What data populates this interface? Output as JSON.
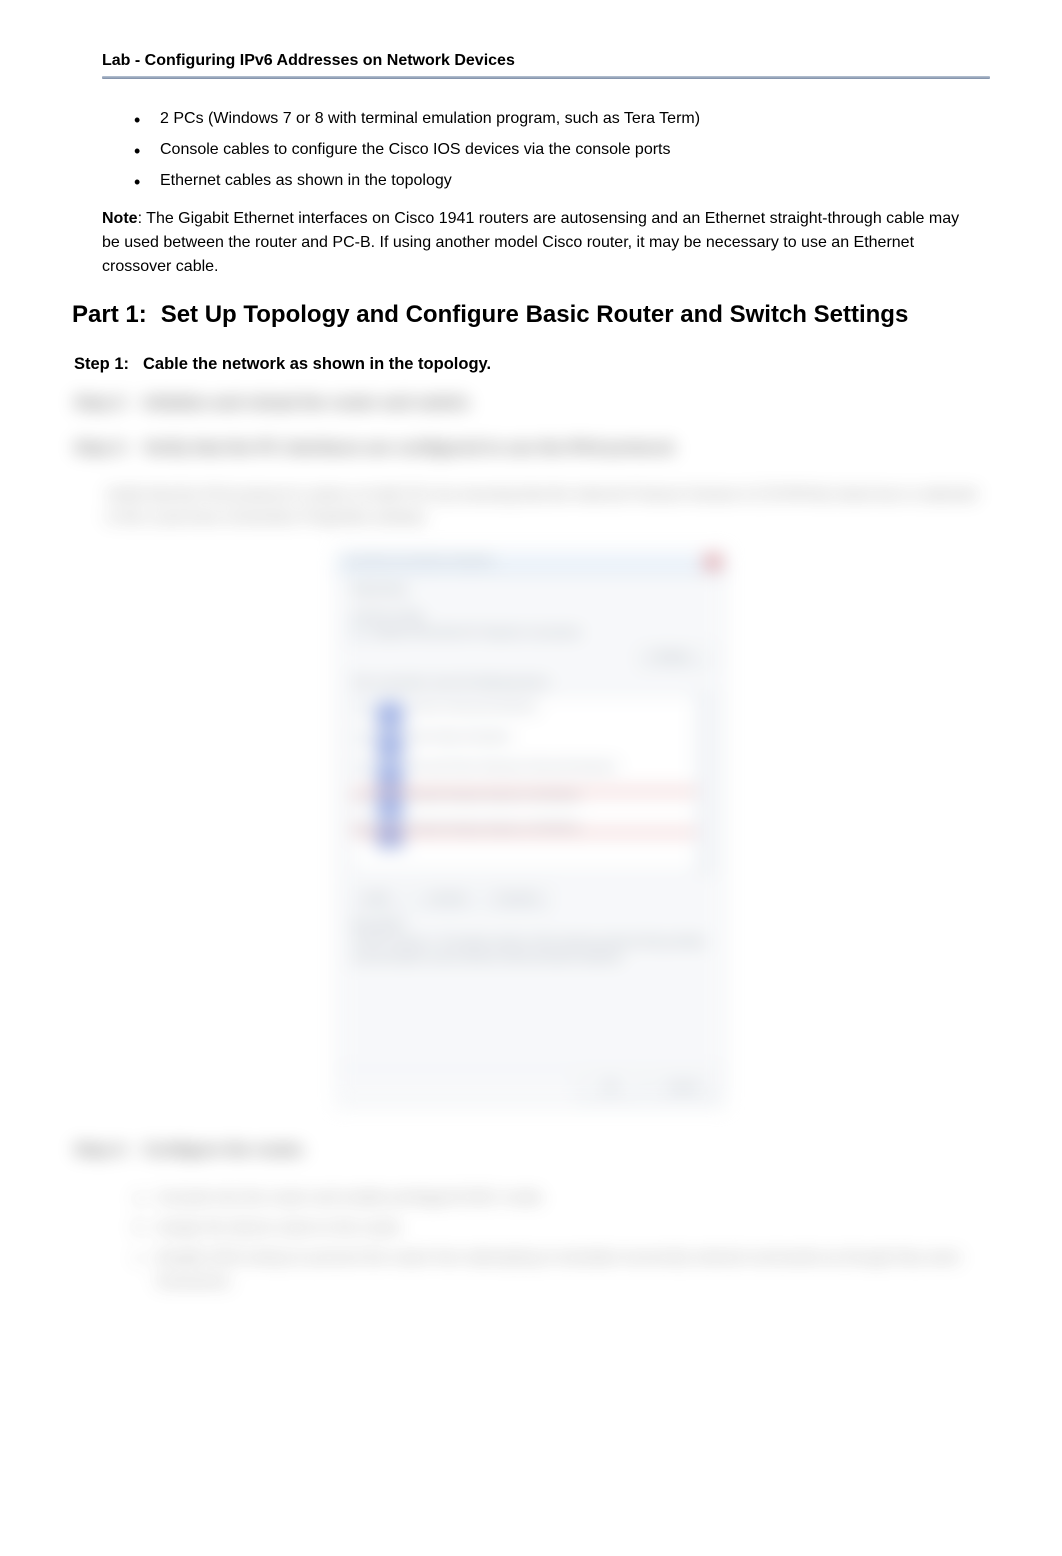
{
  "header": {
    "title": "Lab - Configuring IPv6 Addresses on Network Devices"
  },
  "bullets": {
    "items": [
      "2 PCs (Windows 7 or 8 with terminal emulation program, such as Tera Term)",
      "Console cables to configure the Cisco IOS devices via the console ports",
      "Ethernet cables as shown in the topology"
    ]
  },
  "note": {
    "label": "Note",
    "text": ": The Gigabit Ethernet interfaces on Cisco 1941 routers are autosensing and an Ethernet straight-through cable may be used between the router and PC-B. If using another model Cisco router, it may be necessary to use an Ethernet crossover cable."
  },
  "part": {
    "label": "Part 1:",
    "title": "Set Up Topology and Configure Basic Router and Switch Settings"
  },
  "steps": {
    "s1": {
      "label": "Step 1:",
      "text": "Cable the network as shown in the topology."
    },
    "s2": {
      "label": "Step 2:",
      "text": "Initialize and reload the router and switch."
    },
    "s3": {
      "label": "Step 3:",
      "text": "Verify that the PC interfaces are configured to use the IPv6 protocol."
    },
    "s3_para": "Verify that the IPv6 protocol is active on both PCs by ensuring that the Internet Protocol Version 6 (TCP/IPv6) check box is selected in the Local Area Connection Properties window.",
    "s4": {
      "label": "Step 4:",
      "text": "Configure the router."
    },
    "s4_items": {
      "a": {
        "letter": "a.",
        "text": "Console into the router and enable privileged EXEC mode."
      },
      "b": {
        "letter": "b.",
        "text": "Assign the device name to the router."
      },
      "c": {
        "letter": "c.",
        "text": "Disable DNS lookup to prevent the router from attempting to translate incorrectly entered commands as though they were hostnames."
      }
    }
  },
  "dialog": {
    "title": "Local Area Connection Properties",
    "tab": "Networking",
    "group1_label": "Connect using:",
    "adapter": "Intel(R) PRO/1000 MT Network Connection",
    "configure_btn": "Configure...",
    "group2_label": "This connection uses the following items:",
    "list_items": [
      "Client for Microsoft Networks",
      "QoS Packet Scheduler",
      "File and Printer Sharing for Microsoft Networks",
      "Internet Protocol Version 6 (TCP/IPv6)",
      "Internet Protocol Version 4 (TCP/IPv4)",
      "Link-Layer Topology Discovery Mapper I/O Driver",
      "Link-Layer Topology Discovery Responder"
    ],
    "install_btn": "Install...",
    "uninstall_btn": "Uninstall",
    "properties_btn": "Properties",
    "desc_label": "Description",
    "desc_text": "TCP/IP version 6. The latest version of the internet protocol that provides communication across diverse interconnected networks.",
    "ok_btn": "OK",
    "cancel_btn": "Cancel"
  }
}
